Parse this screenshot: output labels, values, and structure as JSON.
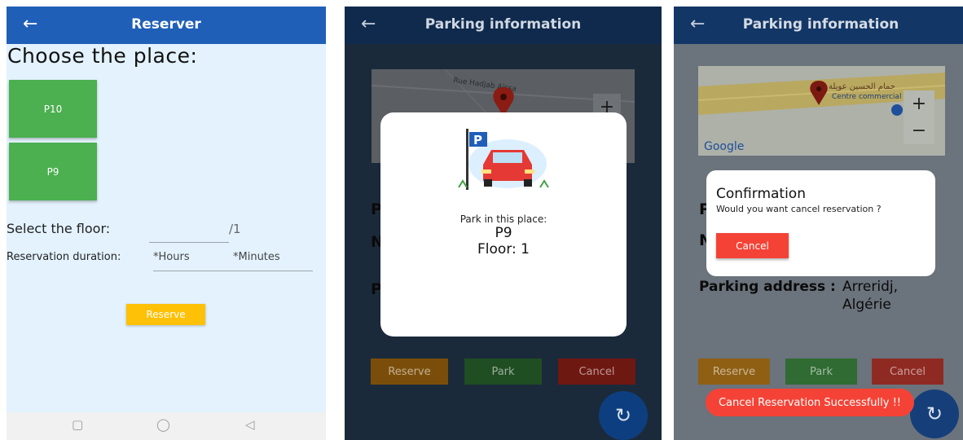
{
  "screen1": {
    "title": "Reserver",
    "back_icon": "arrow-left-icon",
    "heading": "Choose the place:",
    "places": [
      "P10",
      "P9"
    ],
    "floor_label": "Select the floor:",
    "floor_suffix": "/1",
    "duration_label": "Reservation duration:",
    "hours_placeholder": "*Hours",
    "minutes_placeholder": "*Minutes",
    "reserve_label": "Reserve",
    "nav_icons": [
      "square-icon",
      "circle-icon",
      "triangle-back-icon"
    ]
  },
  "screen2": {
    "title": "Parking information",
    "back_icon": "arrow-left-icon",
    "map_street": "Rue Hadjab Aïssa",
    "zoom_in": "+",
    "dialog": {
      "image": "parking-car-illustration",
      "parking_sign": "P",
      "line1": "Park in this place:",
      "line2": "P9",
      "line3": "Floor: 1"
    },
    "partial_letters": [
      "P",
      "N",
      "P"
    ],
    "buttons": [
      "Reserve",
      "Park",
      "Cancel"
    ],
    "refresh_icon": "refresh-icon"
  },
  "screen3": {
    "title": "Parking information",
    "back_icon": "arrow-left-icon",
    "map_label_ar": "حمام الحسين عويلة",
    "map_label_fr": "Centre commercial",
    "google_logo": "Google",
    "zoom_in": "+",
    "zoom_out": "−",
    "dialog": {
      "title": "Confirmation",
      "message": "Would you want cancel reservation ?",
      "cancel_label": "Cancel"
    },
    "partial_letters": [
      "P",
      "N"
    ],
    "address_label": "Parking address :",
    "address_value_1": "Arreridj,",
    "address_value_2": "Algérie",
    "buttons": [
      "Reserve",
      "Park",
      "Cancel"
    ],
    "toast": "Cancel Reservation Successfully !!"
  },
  "colors": {
    "appbar": "#1f5fb8",
    "slot_green": "#4caf50",
    "reserve_yellow": "#ffc107",
    "cancel_red": "#f44336",
    "screen1_bg": "#e3f2fd"
  }
}
